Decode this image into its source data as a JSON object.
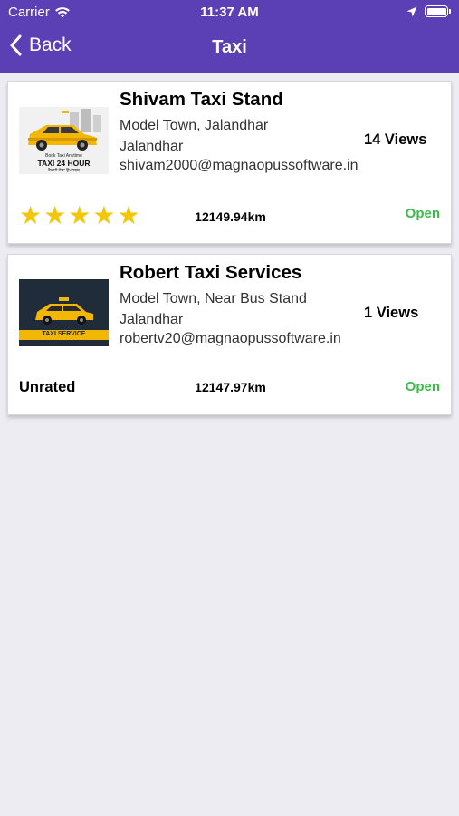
{
  "status_bar": {
    "carrier": "Carrier",
    "time": "11:37 AM"
  },
  "nav": {
    "back_label": "Back",
    "title": "Taxi"
  },
  "colors": {
    "header": "#5b3fb4",
    "open": "#3fb94a",
    "star": "#f2c70a"
  },
  "listings": [
    {
      "name": "Shivam Taxi Stand",
      "address": "Model Town, Jalandhar",
      "city": "Jalandhar",
      "email": "shivam2000@magnaopussoftware.in",
      "views": "14 Views",
      "distance": "12149.94km",
      "status": "Open",
      "rating_stars": 5,
      "thumb_text": {
        "top": "Book Taxi Anytime",
        "main": "TAXI 24 HOUR",
        "sub": "ਟੈਕਸੀ ਸੇਵਾ ਉਪਲਬਧ"
      }
    },
    {
      "name": "Robert Taxi Services",
      "address": "Model Town, Near Bus Stand",
      "city": "Jalandhar",
      "email": "robertv20@magnaopussoftware.in",
      "views": "1 Views",
      "distance": "12147.97km",
      "status": "Open",
      "rating_label": "Unrated",
      "thumb_text": {
        "main": "TAXI SERVICE"
      }
    }
  ]
}
